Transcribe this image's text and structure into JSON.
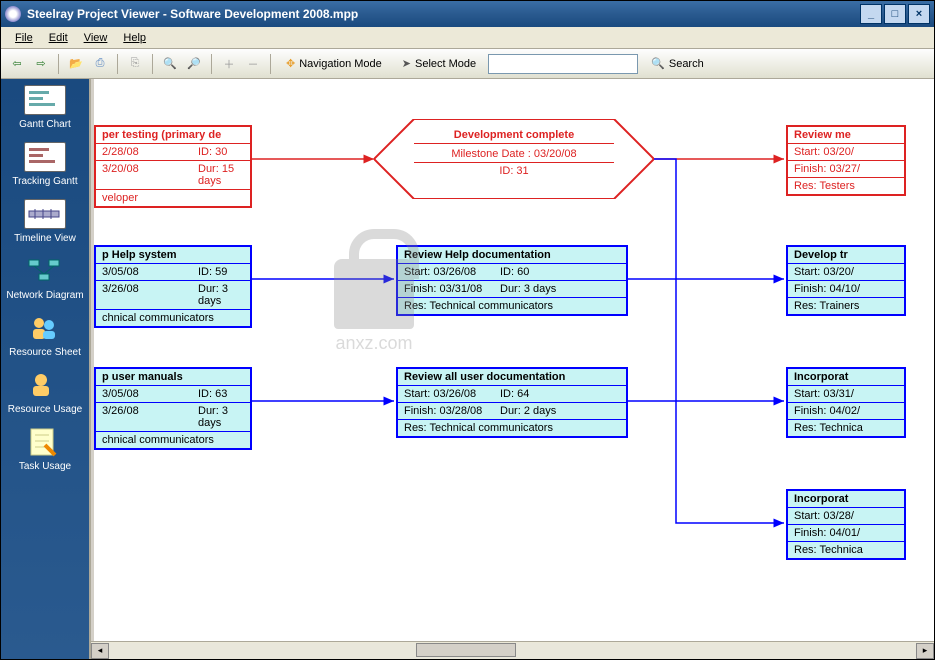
{
  "titlebar": {
    "app": "Steelray Project Viewer",
    "file": "Software Development 2008.mpp",
    "title": "Steelray Project Viewer - Software Development 2008.mpp"
  },
  "menubar": [
    "File",
    "Edit",
    "View",
    "Help"
  ],
  "toolbar": {
    "nav_mode": "Navigation Mode",
    "select_mode": "Select Mode",
    "search_placeholder": "",
    "search_label": "Search"
  },
  "sidebar": {
    "items": [
      {
        "label": "Gantt Chart"
      },
      {
        "label": "Tracking Gantt"
      },
      {
        "label": "Timeline View"
      },
      {
        "label": "Network Diagram"
      },
      {
        "label": "Resource Sheet"
      },
      {
        "label": "Resource Usage"
      },
      {
        "label": "Task Usage"
      }
    ]
  },
  "watermark": "anxz.com",
  "nodes": {
    "dev_testing": {
      "title": "per testing (primary de",
      "row1a": "2/28/08",
      "row1b": "ID:  30",
      "row2a": "3/20/08",
      "row2b": "Dur: 15 days",
      "row3a": "veloper"
    },
    "milestone": {
      "title": "Development complete",
      "date": "Milestone Date : 03/20/08",
      "id": "ID: 31"
    },
    "review_me": {
      "title": "Review me",
      "r1": "Start:  03/20/",
      "r2": "Finish: 03/27/",
      "r3": "Res: Testers"
    },
    "help_system": {
      "title": "p Help system",
      "row1a": "3/05/08",
      "row1b": "ID:  59",
      "row2a": "3/26/08",
      "row2b": "Dur: 3 days",
      "row3a": "chnical communicators"
    },
    "review_help": {
      "title": "Review Help documentation",
      "row1a": "Start:  03/26/08",
      "row1b": "ID:  60",
      "row2a": "Finish: 03/31/08",
      "row2b": "Dur: 3 days",
      "row3a": "Res: Technical communicators"
    },
    "develop_tr": {
      "title": "Develop tr",
      "r1": "Start:  03/20/",
      "r2": "Finish: 04/10/",
      "r3": "Res: Trainers"
    },
    "user_manuals": {
      "title": "p user manuals",
      "row1a": "3/05/08",
      "row1b": "ID:  63",
      "row2a": "3/26/08",
      "row2b": "Dur: 3 days",
      "row3a": "chnical communicators"
    },
    "review_all": {
      "title": "Review all user documentation",
      "row1a": "Start:  03/26/08",
      "row1b": "ID:  64",
      "row2a": "Finish: 03/28/08",
      "row2b": "Dur: 2 days",
      "row3a": "Res: Technical communicators"
    },
    "incorp1": {
      "title": "Incorporat",
      "r1": "Start:  03/31/",
      "r2": "Finish: 04/02/",
      "r3": "Res: Technica"
    },
    "incorp2": {
      "title": "Incorporat",
      "r1": "Start:  03/28/",
      "r2": "Finish: 04/01/",
      "r3": "Res: Technica"
    }
  }
}
